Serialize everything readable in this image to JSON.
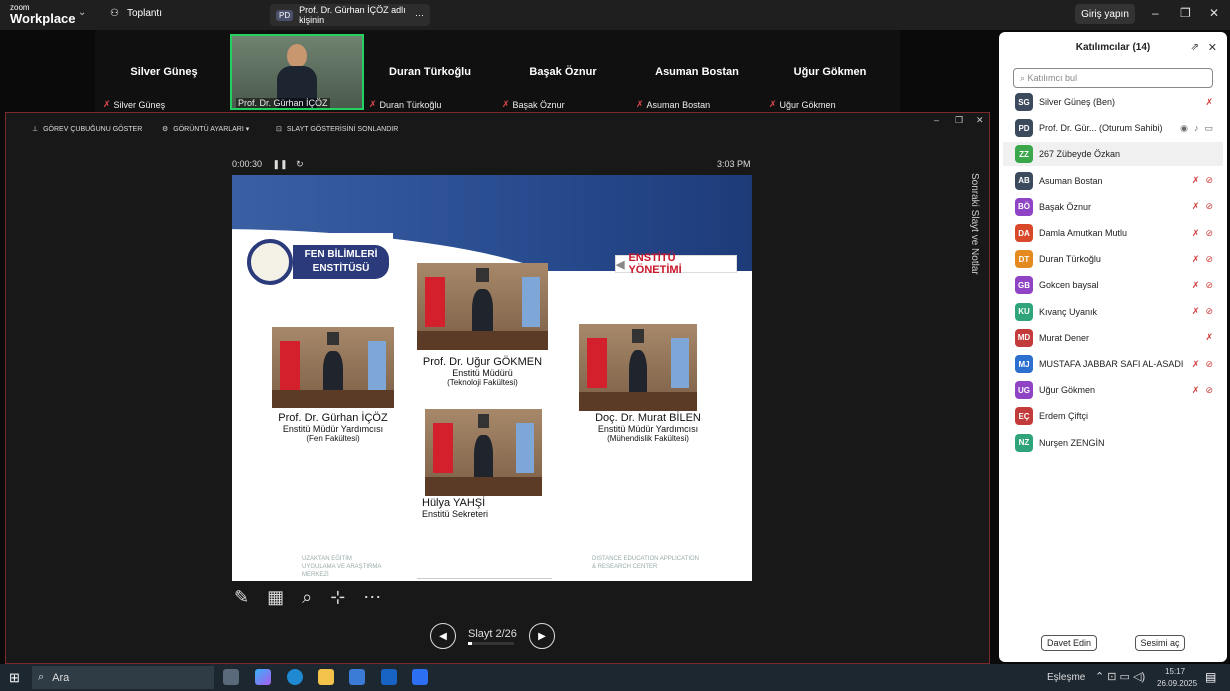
{
  "titlebar": {
    "logo_small": "zoom",
    "logo_big": "Workplace",
    "meeting_label": "Toplantı",
    "share_tab": "Prof. Dr. Gürhan İÇÖZ adlı kişinin",
    "share_badge": "PD",
    "signin": "Giriş yapın"
  },
  "strip": {
    "tiles": [
      {
        "name": "Silver Güneş",
        "label": "Silver Güneş"
      },
      {
        "name": "",
        "label": "Prof. Dr. Gürhan İÇÖZ"
      },
      {
        "name": "Duran Türkoğlu",
        "label": "Duran Türkoğlu"
      },
      {
        "name": "Başak Öznur",
        "label": "Başak Öznur"
      },
      {
        "name": "Asuman Bostan",
        "label": "Asuman Bostan"
      },
      {
        "name": "Uğur Gökmen",
        "label": "Uğur Gökmen"
      }
    ]
  },
  "share": {
    "toolbar": {
      "taskbar": "GÖREV ÇUBUĞUNU GÖSTER",
      "view": "GÖRÜNTÜ AYARLARI ▾",
      "end": "SLAYT GÖSTERİSİNİ SONLANDIR"
    },
    "timer": "0:00:30",
    "clock": "3:03 PM",
    "side_notes": "Sonraki Slayt ve Notlar",
    "slide_counter": "Slayt 2/26"
  },
  "slide": {
    "logo_line1": "FEN BİLİMLERİ",
    "logo_line2": "ENSTİTÜSÜ",
    "title_tag": "ENSTİTÜ YÖNETİMİ",
    "people": [
      {
        "name": "Prof. Dr. Uğur GÖKMEN",
        "role": "Enstitü Müdürü",
        "faculty": "(Teknoloji Fakültesi)"
      },
      {
        "name": "Prof. Dr. Gürhan İÇÖZ",
        "role": "Enstitü Müdür Yardımcısı",
        "faculty": "(Fen Fakültesi)"
      },
      {
        "name": "Doç. Dr. Murat BİLEN",
        "role": "Enstitü Müdür Yardımcısı",
        "faculty": "(Mühendislik Fakültesi)"
      },
      {
        "name": "Hülya YAHŞİ",
        "role": "Enstitü Sekreteri",
        "faculty": ""
      }
    ],
    "footer_left": "UZAKTAN EĞİTİM UYGULAMA VE ARAŞTIRMA MERKEZİ",
    "footer_right": "DISTANCE EDUCATION APPLICATION & RESEARCH CENTER"
  },
  "panel": {
    "title": "Katılımcılar (14)",
    "search_placeholder": "Katılımcı bul",
    "participants": [
      {
        "initials": "SG",
        "name": "Silver Güneş (Ben)",
        "color": "#3b4a5c"
      },
      {
        "initials": "PD",
        "name": "Prof. Dr. Gür... (Oturum Sahibi)",
        "color": "#3b4a5c"
      },
      {
        "initials": "ZZ",
        "name": "267 Zübeyde Özkan",
        "color": "#3aa84a"
      },
      {
        "initials": "AB",
        "name": "Asuman Bostan",
        "color": "#3b4a5c"
      },
      {
        "initials": "BÖ",
        "name": "Başak Öznur",
        "color": "#8e44c4"
      },
      {
        "initials": "DA",
        "name": "Damla Amutkan Mutlu",
        "color": "#d9482b"
      },
      {
        "initials": "DT",
        "name": "Duran Türkoğlu",
        "color": "#e58a1f"
      },
      {
        "initials": "GB",
        "name": "Gokcen baysal",
        "color": "#8e44c4"
      },
      {
        "initials": "KU",
        "name": "Kıvanç Uyanık",
        "color": "#2fa37a"
      },
      {
        "initials": "MD",
        "name": "Murat Dener",
        "color": "#c43b3b"
      },
      {
        "initials": "MJ",
        "name": "MUSTAFA JABBAR SAFI AL-ASADI",
        "color": "#2d6fd1"
      },
      {
        "initials": "UG",
        "name": "Uğur Gökmen",
        "color": "#8e44c4"
      },
      {
        "initials": "EÇ",
        "name": "Erdem Çiftçi",
        "color": "#c43b3b"
      },
      {
        "initials": "NZ",
        "name": "Nurşen ZENGİN",
        "color": "#2fa37a"
      }
    ],
    "invite": "Davet Edin",
    "unmute": "Sesimi aç"
  },
  "taskbar": {
    "search": "Ara",
    "status": "Eşleşme",
    "time": "15:17",
    "date": "26.09.2025"
  }
}
